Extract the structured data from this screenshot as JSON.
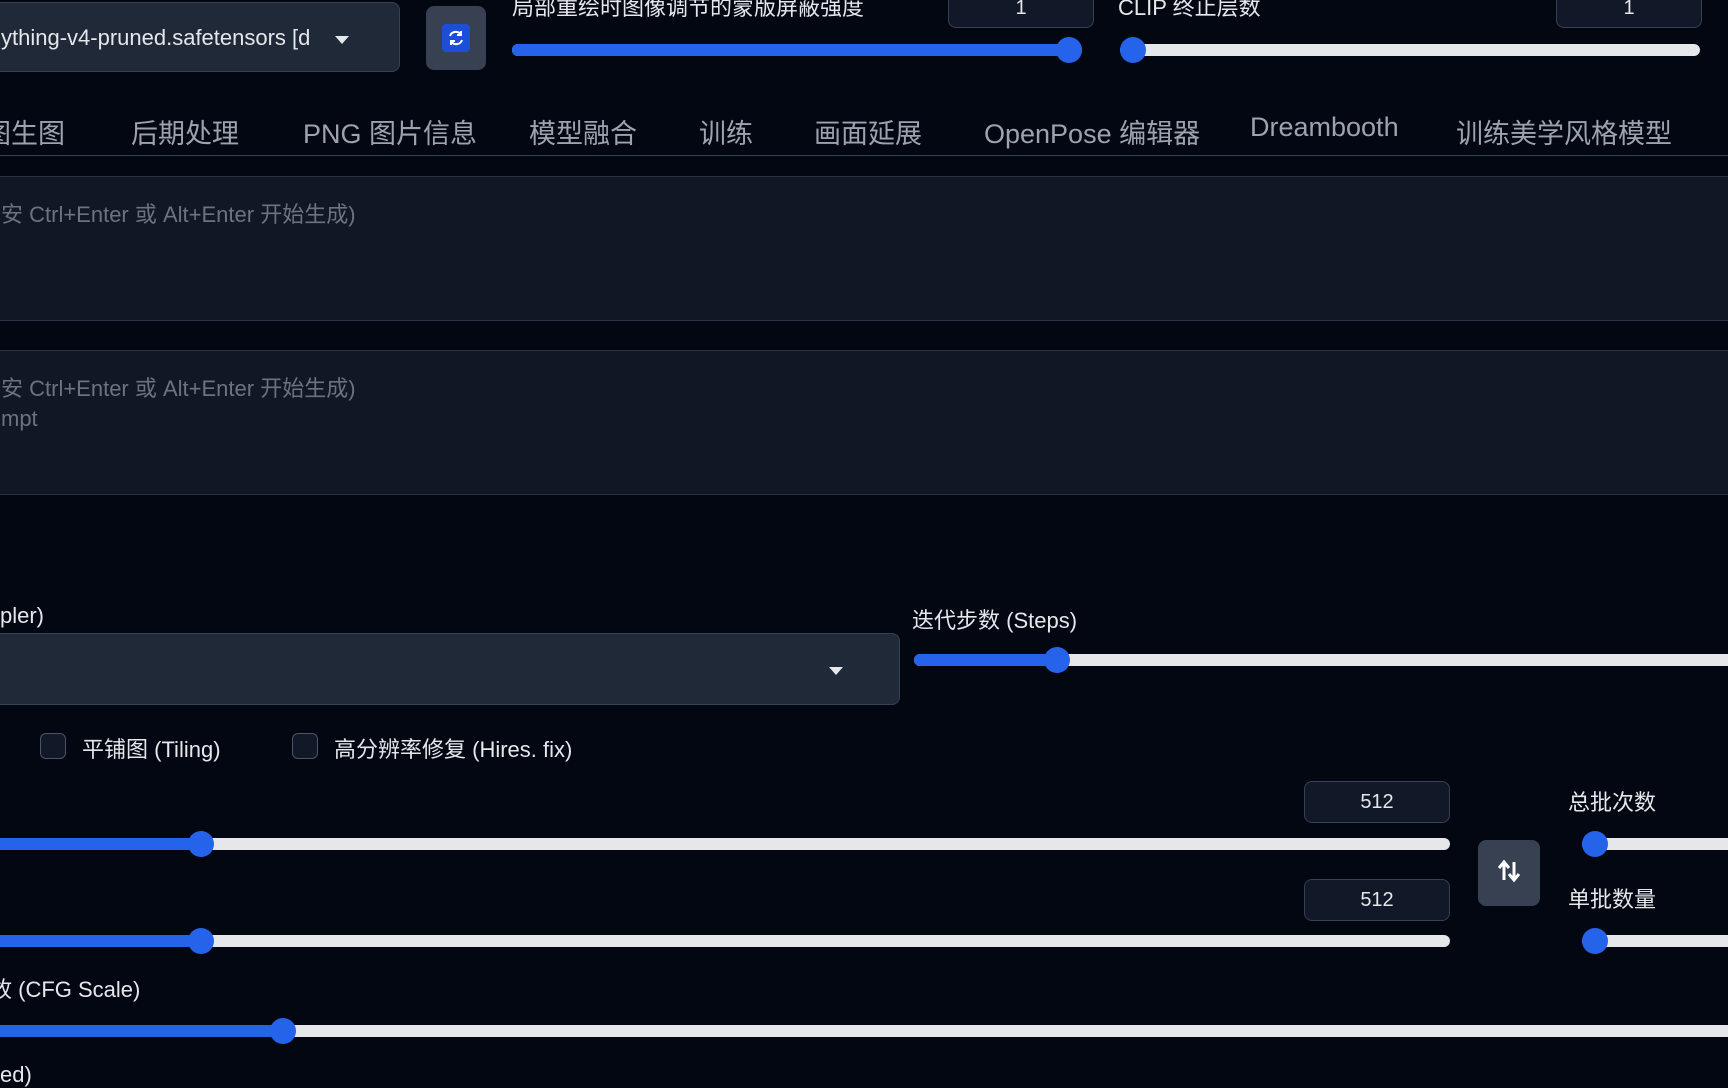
{
  "header": {
    "model_select": {
      "value": "ything-v4-pruned.safetensors [d"
    },
    "mask_strength": {
      "label": "局部重绘时图像调节的蒙版屏蔽强度",
      "value": "1",
      "level": 1.0
    },
    "clip_skip": {
      "label": "CLIP 终止层数",
      "value": "1",
      "level": 0.0
    },
    "refresh_icon": "refresh-icon"
  },
  "tabs": [
    "图生图",
    "后期处理",
    "PNG 图片信息",
    "模型融合",
    "训练",
    "画面延展",
    "OpenPose 编辑器",
    "Dreambooth",
    "训练美学风格模型"
  ],
  "prompt": {
    "placeholder": "安 Ctrl+Enter 或 Alt+Enter 开始生成)"
  },
  "negative_prompt": {
    "placeholder_line1": "安 Ctrl+Enter 或 Alt+Enter 开始生成)",
    "placeholder_line2": "mpt"
  },
  "sampler": {
    "label": "pler)"
  },
  "steps": {
    "label": "迭代步数 (Steps)",
    "level": 0.17
  },
  "options": {
    "tiling_label": "平铺图 (Tiling)",
    "hires_label": "高分辨率修复 (Hires. fix)"
  },
  "width": {
    "value": "512",
    "level": 0.15
  },
  "height": {
    "value": "512",
    "level": 0.15
  },
  "swap_icon": "swap-icon",
  "batch_count": {
    "label": "总批次数",
    "level": 0.0
  },
  "batch_size": {
    "label": "单批数量",
    "level": 0.0
  },
  "cfg": {
    "label": "故 (CFG Scale)",
    "level": 0.17
  },
  "seed": {
    "label": "ed)"
  },
  "colors": {
    "accent": "#2563eb",
    "background": "#030711",
    "panel": "#1f2937"
  }
}
